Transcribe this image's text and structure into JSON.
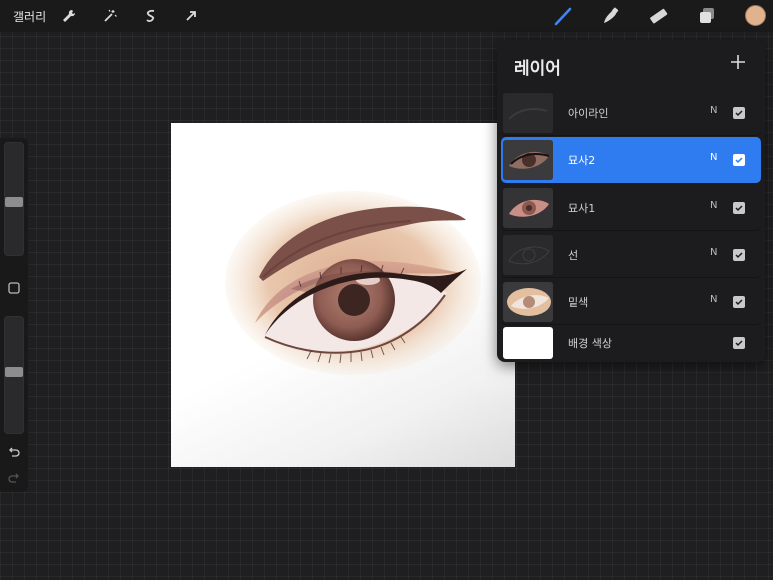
{
  "topbar": {
    "gallery_label": "갤러리",
    "tools_left": [
      {
        "icon": "wrench-icon"
      },
      {
        "icon": "magic-wand-icon"
      },
      {
        "icon": "selection-icon"
      },
      {
        "icon": "transform-arrow-icon"
      }
    ],
    "tools_right": [
      {
        "icon": "brush-icon",
        "active": true
      },
      {
        "icon": "smudge-icon"
      },
      {
        "icon": "eraser-icon"
      },
      {
        "icon": "layers-icon"
      }
    ],
    "current_color": "#e0b28e",
    "accent_color": "#2f7bf0"
  },
  "sidebar": {
    "brush_size_level": 0.5,
    "opacity_level": 0.5
  },
  "layers": {
    "title": "레이어",
    "items": [
      {
        "name": "아이라인",
        "blend": "N",
        "visible": true,
        "selected": false,
        "thumb": "eyeliner"
      },
      {
        "name": "묘사2",
        "blend": "N",
        "visible": true,
        "selected": true,
        "thumb": "eye-dark"
      },
      {
        "name": "묘사1",
        "blend": "N",
        "visible": true,
        "selected": false,
        "thumb": "eye-pink"
      },
      {
        "name": "선",
        "blend": "N",
        "visible": true,
        "selected": false,
        "thumb": "lines"
      },
      {
        "name": "밑색",
        "blend": "N",
        "visible": true,
        "selected": false,
        "thumb": "base"
      },
      {
        "name": "배경 색상",
        "blend": "",
        "visible": true,
        "selected": false,
        "thumb": "white"
      }
    ]
  }
}
